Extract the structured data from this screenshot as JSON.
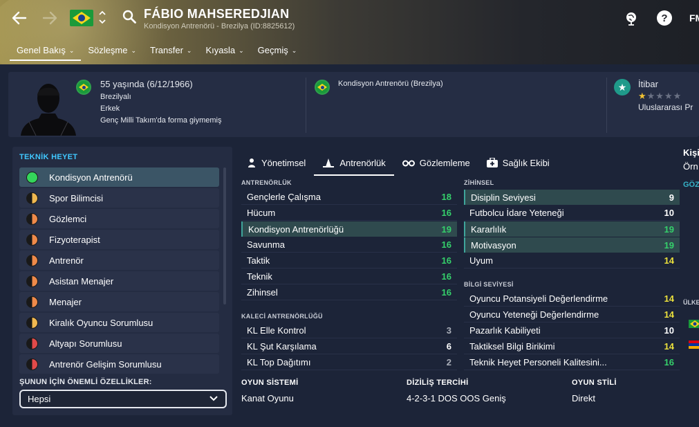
{
  "header": {
    "name": "FÁBIO MAHSEREDJIAN",
    "subtitle": "Kondisyon Antrenörü - Brezilya (ID:8825612)",
    "logo_text": "FM",
    "icons": [
      "back-arrow-icon",
      "forward-arrow-icon",
      "brazil-flag-icon",
      "up-down-icon",
      "search-icon",
      "world-icon",
      "help-icon"
    ]
  },
  "tabs": [
    {
      "label": "Genel Bakış"
    },
    {
      "label": "Sözleşme"
    },
    {
      "label": "Transfer"
    },
    {
      "label": "Kıyasla"
    },
    {
      "label": "Geçmiş"
    }
  ],
  "info": {
    "age": "55 yaşında (6/12/1966)",
    "nationality": "Brezilyalı",
    "gender": "Erkek",
    "youth": "Genç Milli Takım'da forma giymemiş",
    "role": "Kondisyon Antrenörü (Brezilya)",
    "rep_label": "İtibar",
    "rep_level": "Uluslararası Pr",
    "rep_stars": 0.5
  },
  "left_panel": {
    "heading": "TEKNİK HEYET",
    "staff": [
      {
        "label": "Kondisyon Antrenörü",
        "selected": true
      },
      {
        "label": "Spor Bilimcisi"
      },
      {
        "label": "Gözlemci"
      },
      {
        "label": "Fizyoterapist"
      },
      {
        "label": "Antrenör"
      },
      {
        "label": "Asistan Menajer"
      },
      {
        "label": "Menajer"
      },
      {
        "label": "Kiralık Oyuncu Sorumlusu"
      },
      {
        "label": "Altyapı Sorumlusu"
      },
      {
        "label": "Antrenör Gelişim Sorumlusu"
      }
    ],
    "sub_heading": "ŞUNUN İÇİN ÖNEMLİ ÖZELLİKLER:",
    "dropdown_value": "Hepsi"
  },
  "content_tabs": [
    {
      "label": "Yönetimsel"
    },
    {
      "label": "Antrenörlük"
    },
    {
      "label": "Gözlemleme"
    },
    {
      "label": "Sağlık Ekibi"
    }
  ],
  "coaching": {
    "heading": "ANTRENÖRLÜK",
    "rows": [
      {
        "label": "Gençlerle Çalışma",
        "value": "18"
      },
      {
        "label": "Hücum",
        "value": "16"
      },
      {
        "label": "Kondisyon Antrenörlüğü",
        "value": "19"
      },
      {
        "label": "Savunma",
        "value": "16"
      },
      {
        "label": "Taktik",
        "value": "16"
      },
      {
        "label": "Teknik",
        "value": "16"
      },
      {
        "label": "Zihinsel",
        "value": "16"
      }
    ]
  },
  "gk_coaching": {
    "heading": "KALECİ ANTRENÖRLÜĞÜ",
    "rows": [
      {
        "label": "KL Elle Kontrol",
        "value": "3"
      },
      {
        "label": "KL Şut Karşılama",
        "value": "6"
      },
      {
        "label": "KL Top Dağıtımı",
        "value": "2"
      }
    ]
  },
  "mental": {
    "heading": "ZİHİNSEL",
    "rows": [
      {
        "label": "Disiplin Seviyesi",
        "value": "9"
      },
      {
        "label": "Futbolcu İdare Yeteneği",
        "value": "10"
      },
      {
        "label": "Kararlılık",
        "value": "19"
      },
      {
        "label": "Motivasyon",
        "value": "19"
      },
      {
        "label": "Uyum",
        "value": "14"
      }
    ]
  },
  "knowledge": {
    "heading": "BİLGİ SEVİYESİ",
    "rows": [
      {
        "label": "Oyuncu Potansiyeli Değerlendirme",
        "value": "14"
      },
      {
        "label": "Oyuncu Yeteneği Değerlendirme",
        "value": "14"
      },
      {
        "label": "Pazarlık Kabiliyeti",
        "value": "10"
      },
      {
        "label": "Taktiksel Bilgi Birikimi",
        "value": "14"
      },
      {
        "label": "Teknik Heyet Personeli Kalitesini...",
        "value": "16"
      }
    ]
  },
  "bottom": {
    "system_label": "OYUN SİSTEMİ",
    "system_value": "Kanat Oyunu",
    "formation_label": "DİZİLİŞ TERCİHİ",
    "formation_value": "4-2-3-1 DOS OOS Geniş",
    "style_label": "OYUN STİLİ",
    "style_value": "Direkt"
  },
  "right_cut": {
    "t1": "Kişi",
    "t2": "Örn",
    "t3": "GÖZ",
    "t4": "ÜLKE"
  },
  "colors": {
    "accent_teal": "#40c8ff",
    "value_green": "#35d06b",
    "value_yellow": "#ece13c",
    "selected_row": "#3b5566"
  }
}
